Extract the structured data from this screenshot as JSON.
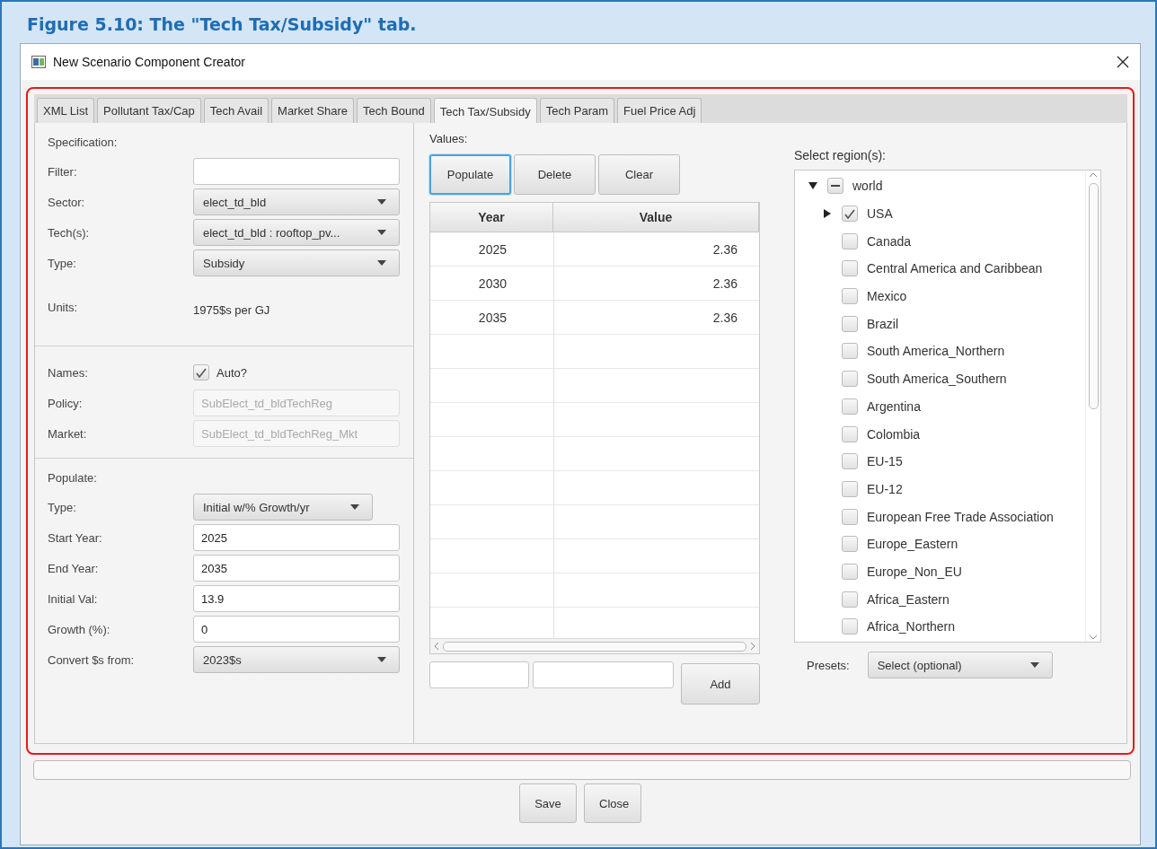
{
  "caption": "Figure 5.10: The \"Tech Tax/Subsidy\" tab.",
  "window": {
    "title": "New Scenario Component Creator"
  },
  "tabs": [
    {
      "label": "XML List",
      "selected": false
    },
    {
      "label": "Pollutant Tax/Cap",
      "selected": false
    },
    {
      "label": "Tech Avail",
      "selected": false
    },
    {
      "label": "Market Share",
      "selected": false
    },
    {
      "label": "Tech Bound",
      "selected": false
    },
    {
      "label": "Tech Tax/Subsidy",
      "selected": true
    },
    {
      "label": "Tech Param",
      "selected": false
    },
    {
      "label": "Fuel Price Adj",
      "selected": false
    }
  ],
  "form_sections": [
    {
      "heading": "Specification:",
      "fields": [
        {
          "label": "Filter:",
          "kind": "text"
        },
        {
          "label": "Sector:",
          "kind": "dropdown",
          "value": "elect_td_bld"
        },
        {
          "label": "Tech(s):",
          "kind": "dropdown",
          "value": "elect_td_bld : rooftop_pv..."
        },
        {
          "label": "Type:",
          "kind": "dropdown",
          "value": "Subsidy"
        },
        {
          "label": "Units:",
          "kind": "readout",
          "value": "1975$s per GJ"
        }
      ]
    },
    {
      "fields": [
        {
          "label": "Names:",
          "kind": "checkbox",
          "checked": true,
          "value": "Auto?"
        },
        {
          "label": "Policy:",
          "kind": "text",
          "disabled": true,
          "value": "SubElect_td_bldTechReg"
        },
        {
          "label": "Market:",
          "kind": "text",
          "disabled": true,
          "value": "SubElect_td_bldTechReg_Mkt"
        }
      ]
    },
    {
      "heading": "Populate:",
      "fields": [
        {
          "label": "Type:",
          "kind": "dropdown-short",
          "value": "Initial w/% Growth/yr"
        },
        {
          "label": "Start Year:",
          "kind": "text",
          "disabled": false,
          "value": "2025"
        },
        {
          "label": "End Year:",
          "kind": "text",
          "disabled": false,
          "value": "2035"
        },
        {
          "label": "Initial Val:",
          "kind": "text",
          "disabled": false,
          "value": "13.9"
        },
        {
          "label": "Growth (%):",
          "kind": "text",
          "disabled": false,
          "value": "0"
        },
        {
          "label": "Convert $s from:",
          "kind": "dropdown",
          "value": "2023$s"
        }
      ]
    }
  ],
  "values": {
    "heading": "Values:",
    "buttons": [
      {
        "label": "Populate",
        "focused": true
      },
      {
        "label": "Delete",
        "focused": false
      },
      {
        "label": "Clear",
        "focused": false
      }
    ],
    "table": {
      "columns": [
        "Year",
        "Value"
      ],
      "rows": [
        [
          "2025",
          "2.36"
        ],
        [
          "2030",
          "2.36"
        ],
        [
          "2035",
          "2.36"
        ]
      ]
    },
    "add_button": "Add"
  },
  "regions": {
    "heading": "Select region(s):",
    "root": {
      "label": "world",
      "expanded": true,
      "indeterminate": true,
      "children": [
        {
          "label": "USA",
          "expanded": false,
          "checked": true
        },
        {
          "label": "Canada",
          "checked": false
        },
        {
          "label": "Central America and Caribbean",
          "checked": false
        },
        {
          "label": "Mexico",
          "checked": false
        },
        {
          "label": "Brazil",
          "checked": false
        },
        {
          "label": "South America_Northern",
          "checked": false
        },
        {
          "label": "South America_Southern",
          "checked": false
        },
        {
          "label": "Argentina",
          "checked": false
        },
        {
          "label": "Colombia",
          "checked": false
        },
        {
          "label": "EU-15",
          "checked": false
        },
        {
          "label": "EU-12",
          "checked": false
        },
        {
          "label": "European Free Trade Association",
          "checked": false
        },
        {
          "label": "Europe_Eastern",
          "checked": false
        },
        {
          "label": "Europe_Non_EU",
          "checked": false
        },
        {
          "label": "Africa_Eastern",
          "checked": false
        },
        {
          "label": "Africa_Northern",
          "checked": false
        }
      ]
    },
    "presets_label": "Presets:",
    "presets_value": "Select (optional)"
  },
  "progress": {
    "level": 0
  },
  "footer_buttons": [
    "Save",
    "Close"
  ]
}
